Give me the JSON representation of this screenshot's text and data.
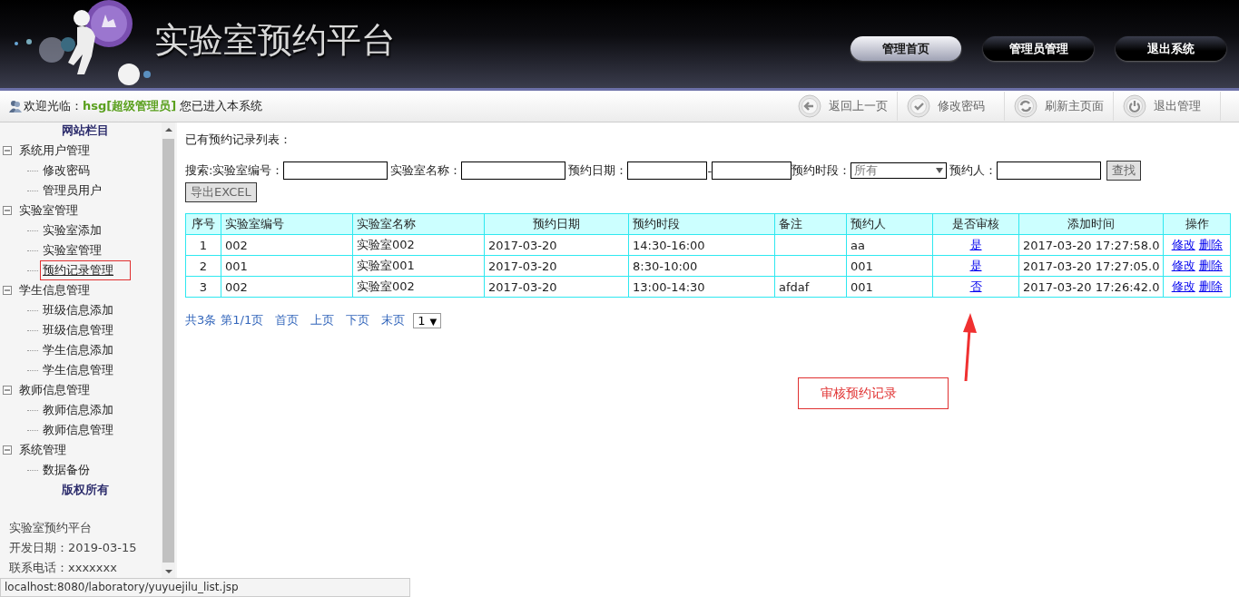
{
  "header": {
    "title": "实验室预约平台",
    "nav": [
      {
        "label": "管理首页",
        "selected": true
      },
      {
        "label": "管理员管理",
        "selected": false
      },
      {
        "label": "退出系统",
        "selected": false
      }
    ]
  },
  "toolbar": {
    "welcome": {
      "prefix": "欢迎光临：",
      "user": "hsg[超级管理员]",
      "suffix": "您已进入本系统"
    },
    "actions": [
      {
        "label": "返回上一页",
        "kind": "back"
      },
      {
        "label": "修改密码",
        "kind": "check"
      },
      {
        "label": "刷新主页面",
        "kind": "refresh"
      },
      {
        "label": "退出管理",
        "kind": "power"
      }
    ]
  },
  "sidebar": {
    "title": "网站栏目",
    "groups": [
      {
        "label": "系统用户管理",
        "expanded": true,
        "children": [
          {
            "label": "修改密码",
            "selected": false
          },
          {
            "label": "管理员用户",
            "selected": false
          }
        ]
      },
      {
        "label": "实验室管理",
        "expanded": true,
        "children": [
          {
            "label": "实验室添加",
            "selected": false
          },
          {
            "label": "实验室管理",
            "selected": false
          },
          {
            "label": "预约记录管理",
            "selected": true
          }
        ]
      },
      {
        "label": "学生信息管理",
        "expanded": true,
        "children": [
          {
            "label": "班级信息添加",
            "selected": false
          },
          {
            "label": "班级信息管理",
            "selected": false
          },
          {
            "label": "学生信息添加",
            "selected": false
          },
          {
            "label": "学生信息管理",
            "selected": false
          }
        ]
      },
      {
        "label": "教师信息管理",
        "expanded": true,
        "children": [
          {
            "label": "教师信息添加",
            "selected": false
          },
          {
            "label": "教师信息管理",
            "selected": false
          }
        ]
      },
      {
        "label": "系统管理",
        "expanded": true,
        "children": [
          {
            "label": "数据备份",
            "selected": false
          }
        ]
      }
    ],
    "copyright_title": "版权所有",
    "footer": [
      "实验室预约平台",
      "开发日期：2019-03-15",
      "联系电话：xxxxxxx"
    ]
  },
  "main": {
    "heading": "已有预约记录列表：",
    "search": {
      "label": "搜索:",
      "fields": [
        {
          "label": "实验室编号：",
          "kind": "text"
        },
        {
          "label": "实验室名称：",
          "kind": "text"
        },
        {
          "label": "预约日期：",
          "kind": "range",
          "separator": "-"
        },
        {
          "label": "预约时段：",
          "kind": "select",
          "value": "所有"
        },
        {
          "label": "预约人：",
          "kind": "text"
        }
      ],
      "button": "查找"
    },
    "export_button": "导出EXCEL",
    "table": {
      "columns": [
        "序号",
        "实验室编号",
        "实验室名称",
        "预约日期",
        "预约时段",
        "备注",
        "预约人",
        "是否审核",
        "添加时间",
        "操作"
      ],
      "rows": [
        {
          "cells": [
            "1",
            "002",
            "实验室002",
            "2017-03-20",
            "14:30-16:00",
            "",
            "aa"
          ],
          "approved": "是",
          "added": "2017-03-20 17:27:58.0",
          "actions": [
            "修改",
            "删除"
          ]
        },
        {
          "cells": [
            "2",
            "001",
            "实验室001",
            "2017-03-20",
            "8:30-10:00",
            "",
            "001"
          ],
          "approved": "是",
          "added": "2017-03-20 17:27:05.0",
          "actions": [
            "修改",
            "删除"
          ]
        },
        {
          "cells": [
            "3",
            "002",
            "实验室002",
            "2017-03-20",
            "13:00-14:30",
            "afdaf",
            "001"
          ],
          "approved": "否",
          "added": "2017-03-20 17:26:42.0",
          "actions": [
            "修改",
            "删除"
          ]
        }
      ]
    },
    "pagination": {
      "summary": [
        "共3条",
        "第1/1页"
      ],
      "links": [
        "首页",
        "上页",
        "下页",
        "末页"
      ],
      "page_select": {
        "value": "1",
        "arrow": "▼"
      }
    },
    "annotation": {
      "text": "审核预约记录"
    }
  },
  "status_bar": {
    "url": "localhost:8080/laboratory/yuyuejilu_list.jsp"
  }
}
